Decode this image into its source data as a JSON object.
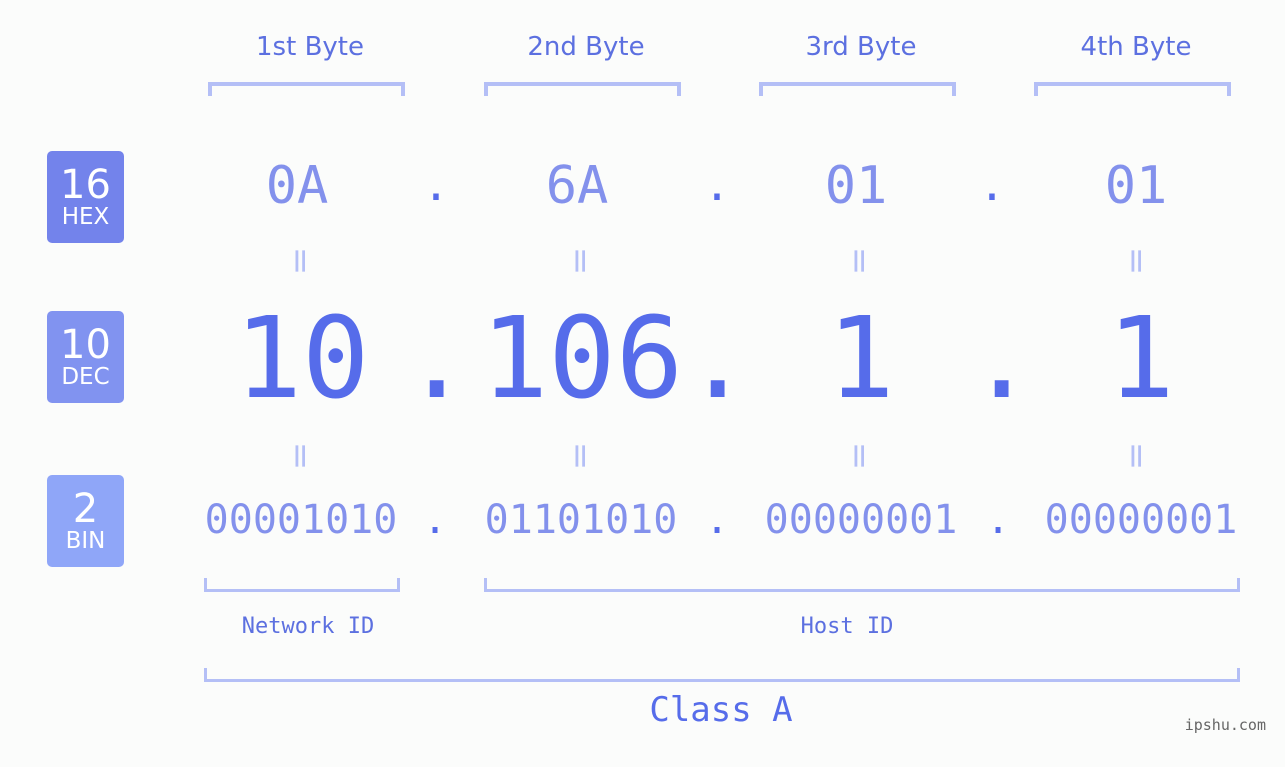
{
  "badges": [
    {
      "number": "16",
      "label": "HEX"
    },
    {
      "number": "10",
      "label": "DEC"
    },
    {
      "number": "2",
      "label": "BIN"
    }
  ],
  "byte_headers": [
    "1st Byte",
    "2nd Byte",
    "3rd Byte",
    "4th Byte"
  ],
  "hex": [
    "0A",
    "6A",
    "01",
    "01"
  ],
  "dec": [
    "10",
    "106",
    "1",
    "1"
  ],
  "bin": [
    "00001010",
    "01101010",
    "00000001",
    "00000001"
  ],
  "separator": ".",
  "equals": "=",
  "network_label": "Network ID",
  "host_label": "Host ID",
  "class_label": "Class A",
  "watermark": "ipshu.com",
  "colors": {
    "accent": "#566cea",
    "light": "#8391ec",
    "bracket": "#b4bff6",
    "hex_badge": "#7383eb",
    "dec_badge": "#8193f0",
    "bin_badge": "#8fa6f8"
  }
}
